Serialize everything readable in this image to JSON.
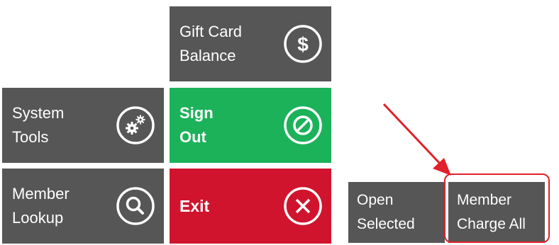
{
  "colors": {
    "tile_gray": "#565656",
    "sign_out_green": "#1cb25a",
    "exit_red": "#d0142e",
    "highlight_red": "#e0202a",
    "text_white": "#ffffff"
  },
  "tiles": {
    "gift_card_balance": {
      "line1": "Gift Card",
      "line2": "Balance",
      "icon": "dollar-circle-icon"
    },
    "system_tools": {
      "line1": "System",
      "line2": "Tools",
      "icon": "gears-circle-icon"
    },
    "sign_out": {
      "line1": "Sign",
      "line2": "Out",
      "icon": "prohibited-circle-icon"
    },
    "member_lookup": {
      "line1": "Member",
      "line2": "Lookup",
      "icon": "search-circle-icon"
    },
    "exit": {
      "label": "Exit",
      "icon": "close-circle-icon"
    }
  },
  "buttons": {
    "open_selected": {
      "line1": "Open",
      "line2": "Selected"
    },
    "member_charge_all": {
      "line1": "Member",
      "line2": "Charge All"
    }
  }
}
